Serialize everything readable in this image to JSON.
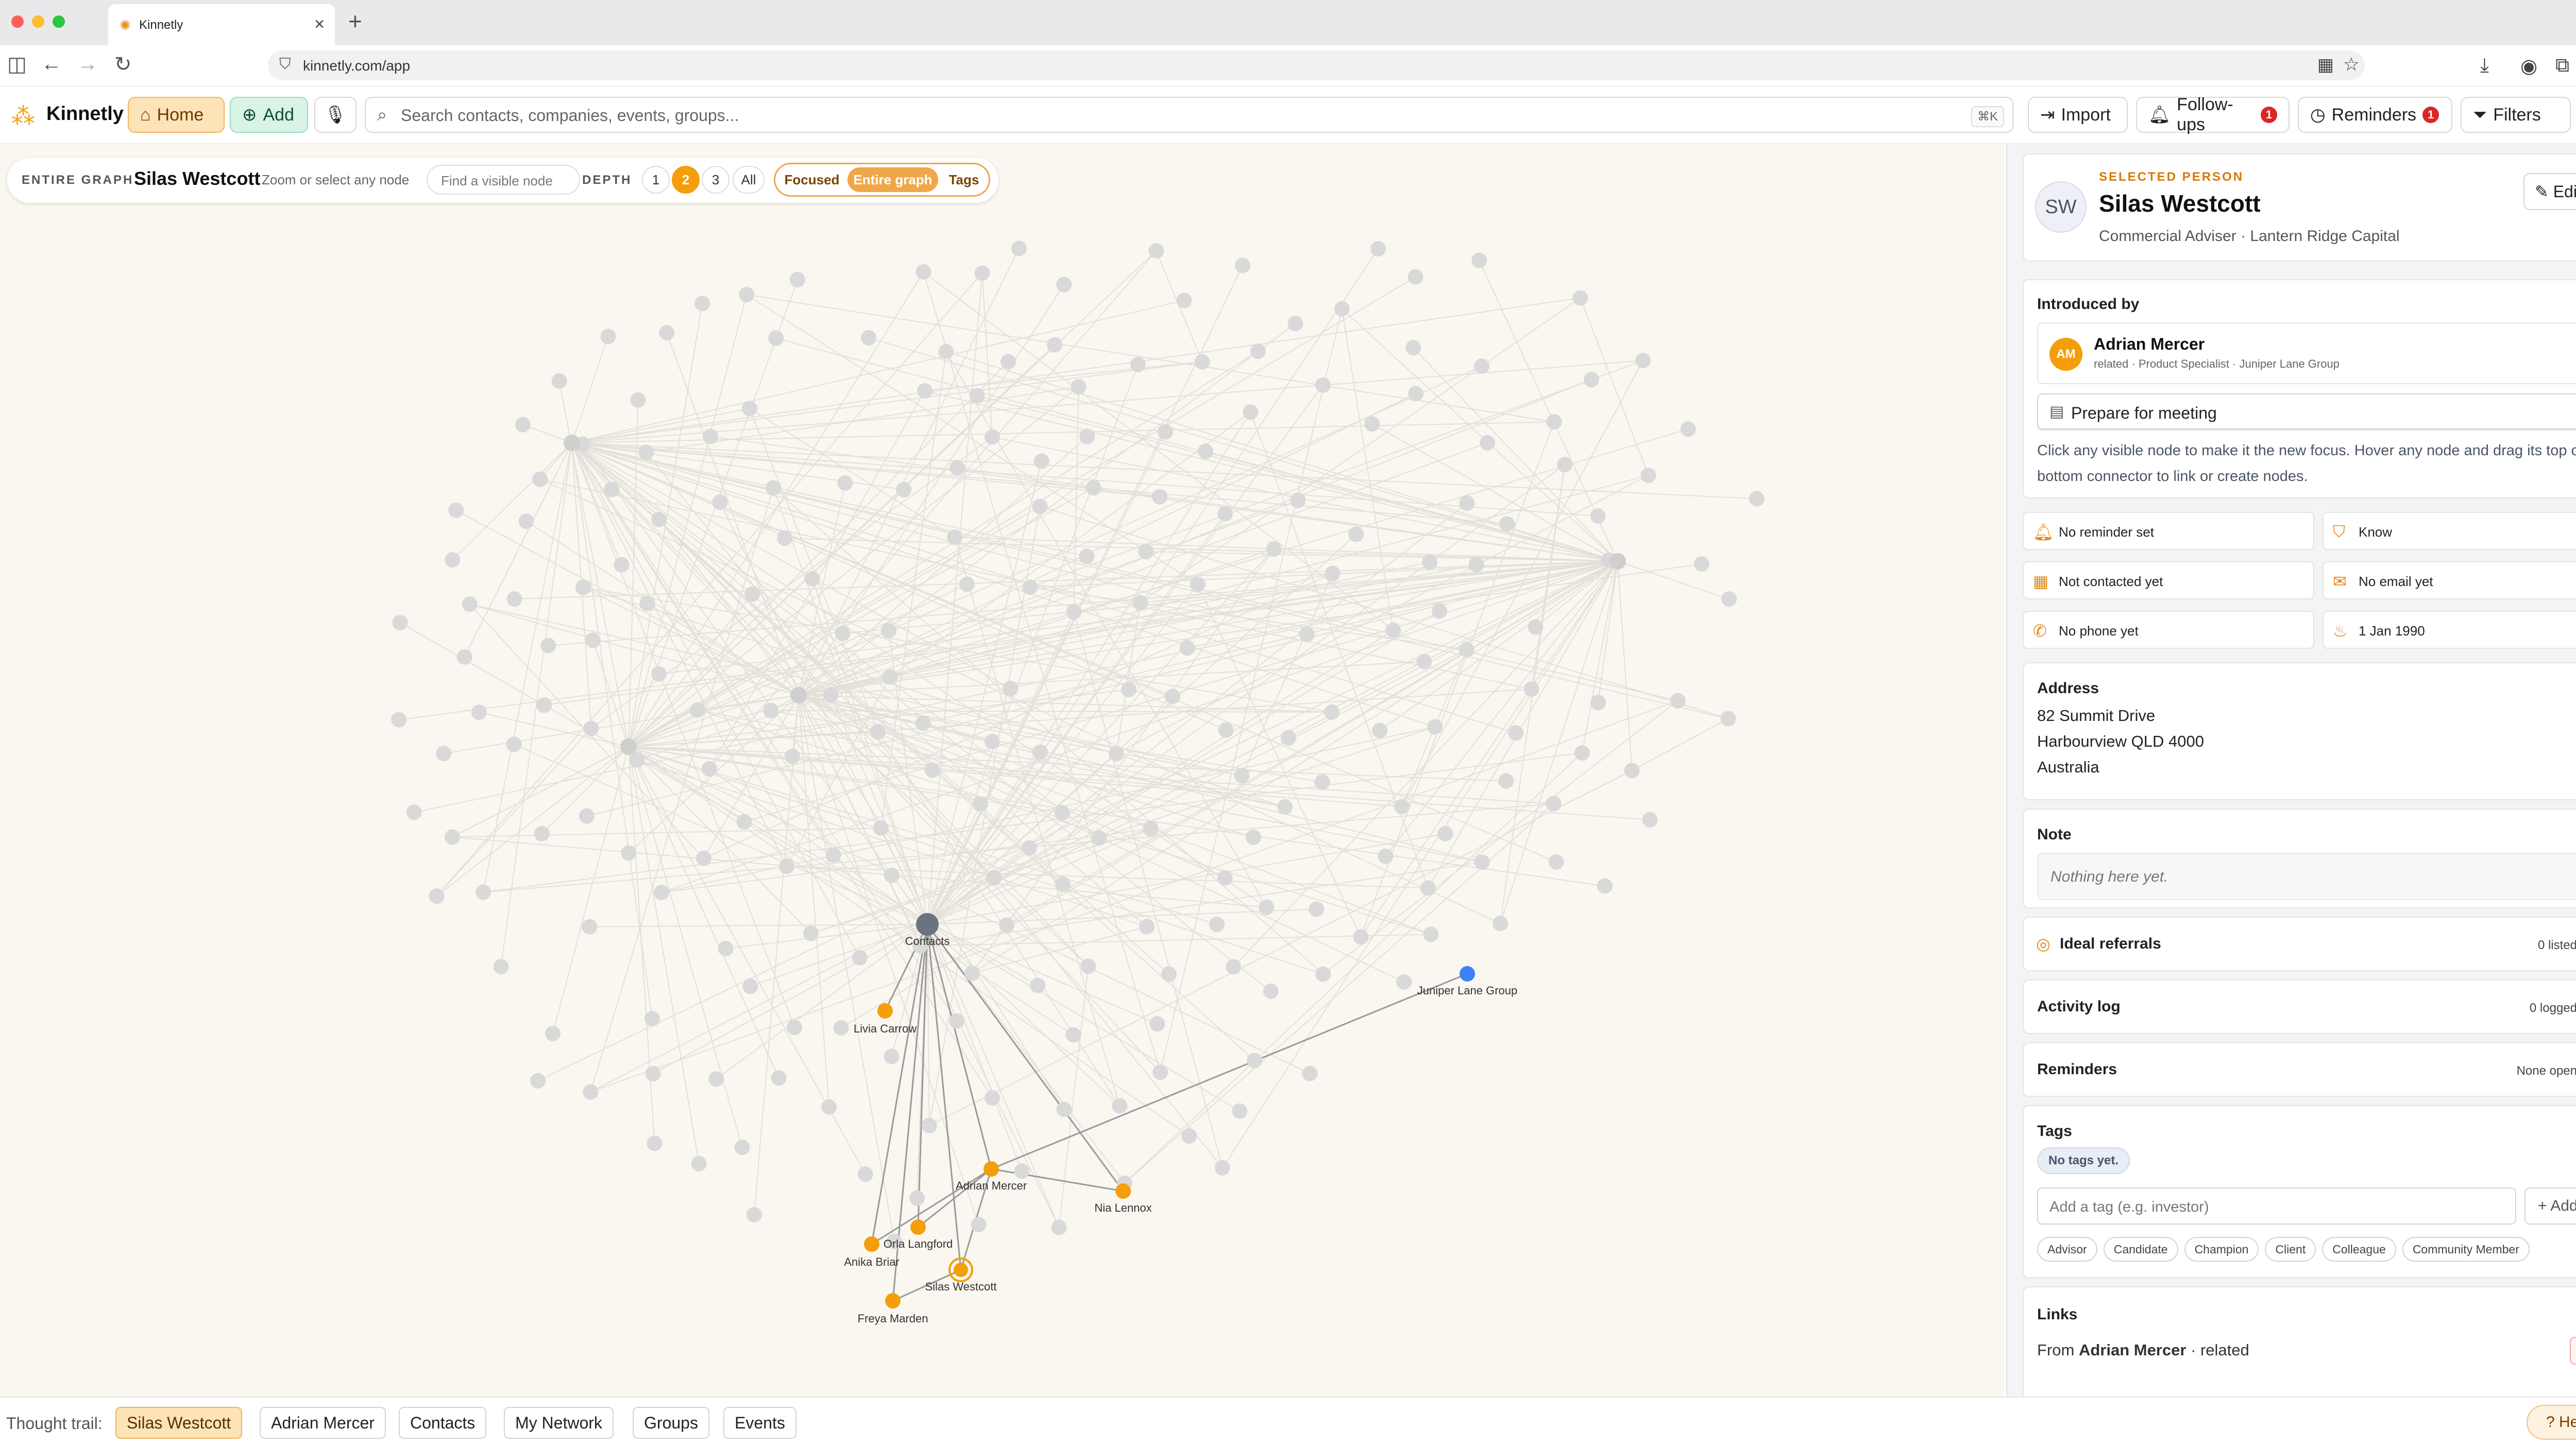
{
  "browser": {
    "tab_title": "Kinnetly",
    "url": "kinnetly.com/app"
  },
  "header": {
    "brand": "Kinnetly",
    "home_label": "Home",
    "add_label": "Add",
    "search_placeholder": "Search contacts, companies, events, groups...",
    "search_shortcut": "⌘K",
    "import_label": "Import",
    "followups_label": "Follow-ups",
    "followups_count": "1",
    "reminders_label": "Reminders",
    "reminders_count": "1",
    "filters_label": "Filters"
  },
  "graph_controls": {
    "scope_label": "ENTIRE GRAPH",
    "focus_name": "Silas Westcott",
    "hint": "Zoom or select any node",
    "find_placeholder": "Find a visible node",
    "depth_label": "DEPTH",
    "depth_options": [
      "1",
      "2",
      "3",
      "All"
    ],
    "depth_selected": "2",
    "modes": [
      "Focused",
      "Entire graph",
      "Tags"
    ],
    "mode_selected": "Entire graph"
  },
  "graph": {
    "hub_label": "Contacts",
    "highlighted_nodes": [
      {
        "id": "contacts",
        "label": "Contacts",
        "kind": "hub"
      },
      {
        "id": "livia",
        "label": "Livia Carrow",
        "kind": "person"
      },
      {
        "id": "juniper",
        "label": "Juniper Lane Group",
        "kind": "company"
      },
      {
        "id": "adrian",
        "label": "Adrian Mercer",
        "kind": "person"
      },
      {
        "id": "nia",
        "label": "Nia Lennox",
        "kind": "person"
      },
      {
        "id": "orla",
        "label": "Orla Langford",
        "kind": "person"
      },
      {
        "id": "anika",
        "label": "Anika Briar",
        "kind": "person"
      },
      {
        "id": "silas",
        "label": "Silas Westcott",
        "kind": "selected"
      },
      {
        "id": "freya",
        "label": "Freya Marden",
        "kind": "person"
      }
    ],
    "colors": {
      "background": "#faf7f0",
      "dim_node": "#d9d9d9",
      "dim_edge": "#e3e0da",
      "person": "#f59e0b",
      "company": "#3b82f6",
      "hub": "#6b7280"
    }
  },
  "panel": {
    "selected_label": "SELECTED PERSON",
    "initials": "SW",
    "name": "Silas Westcott",
    "subtitle": "Commercial Adviser · Lantern Ridge Capital",
    "edit_label": "Edit",
    "introduced_by_title": "Introduced by",
    "introducer_initials": "AM",
    "introducer_name": "Adrian Mercer",
    "introducer_detail": "related · Product Specialist · Juniper Lane Group",
    "prepare_label": "Prepare for meeting",
    "help_text": "Click any visible node to make it the new focus. Hover any node and drag its top or bottom connector to link or create nodes.",
    "chips": [
      {
        "icon": "bell-icon",
        "text": "No reminder set"
      },
      {
        "icon": "shield-icon",
        "text": "Know"
      },
      {
        "icon": "calendar-icon",
        "text": "Not contacted yet"
      },
      {
        "icon": "mail-icon",
        "text": "No email yet"
      },
      {
        "icon": "phone-icon",
        "text": "No phone yet"
      },
      {
        "icon": "cake-icon",
        "text": "1 Jan 1990"
      }
    ],
    "address_title": "Address",
    "address_lines": [
      "82 Summit Drive",
      "Harbourview QLD 4000",
      "Australia"
    ],
    "note_title": "Note",
    "note_placeholder": "Nothing here yet.",
    "ideal_referrals_title": "Ideal referrals",
    "ideal_referrals_status": "0 listed",
    "activity_title": "Activity log",
    "activity_status": "0 logged",
    "reminders_title": "Reminders",
    "reminders_status": "None open",
    "tags_title": "Tags",
    "tags_empty": "No tags yet.",
    "tag_input_placeholder": "Add a tag (e.g. investor)",
    "tag_add_label": "Add",
    "tag_suggestions": [
      "Advisor",
      "Candidate",
      "Champion",
      "Client",
      "Colleague",
      "Community Member"
    ],
    "links_title": "Links",
    "links_from": "From",
    "links_person": "Adrian Mercer",
    "links_relation": "· related"
  },
  "trail": {
    "label": "Thought trail:",
    "items": [
      "Silas Westcott",
      "Adrian Mercer",
      "Contacts",
      "My Network",
      "Groups",
      "Events"
    ],
    "active": "Silas Westcott"
  },
  "help_label": "Help"
}
